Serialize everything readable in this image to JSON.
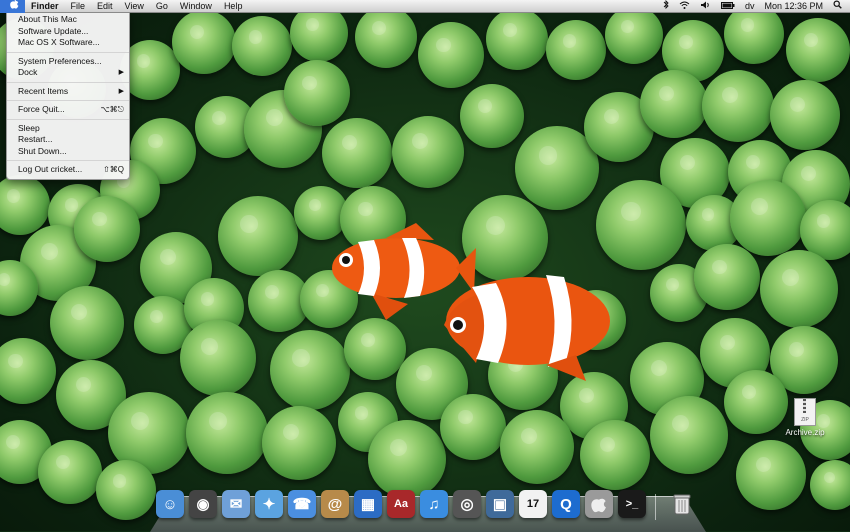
{
  "menubar": {
    "apple_icon": "",
    "items": [
      "Finder",
      "File",
      "Edit",
      "View",
      "Go",
      "Window",
      "Help"
    ],
    "status": {
      "bluetooth_icon": "bluetooth-icon",
      "wifi_icon": "wifi-icon",
      "volume_icon": "volume-icon",
      "battery_icon": "battery-icon",
      "user": "dv",
      "clock": "Mon 12:36 PM",
      "spotlight_icon": "spotlight-icon"
    }
  },
  "apple_menu": {
    "items": [
      {
        "label": "About This Mac"
      },
      {
        "label": "Software Update..."
      },
      {
        "label": "Mac OS X Software..."
      },
      {
        "separator": true
      },
      {
        "label": "System Preferences..."
      },
      {
        "label": "Dock",
        "submenu": true
      },
      {
        "separator": true
      },
      {
        "label": "Recent Items",
        "submenu": true
      },
      {
        "separator": true
      },
      {
        "label": "Force Quit...",
        "shortcut": "⌥⌘⎋"
      },
      {
        "separator": true
      },
      {
        "label": "Sleep"
      },
      {
        "label": "Restart..."
      },
      {
        "label": "Shut Down..."
      },
      {
        "separator": true
      },
      {
        "label": "Log Out cricket...",
        "shortcut": "⇧⌘Q"
      }
    ]
  },
  "desktop": {
    "wallpaper": "clownfish-anemone",
    "files": [
      {
        "label": "Archive.zip",
        "icon_text": "ZIP"
      }
    ]
  },
  "dock": {
    "apps": [
      {
        "name": "finder",
        "glyph": "☺",
        "color": "#4a8ed6"
      },
      {
        "name": "dashboard",
        "glyph": "◉",
        "color": "#444444"
      },
      {
        "name": "mail",
        "glyph": "✉",
        "color": "#6fa0d8"
      },
      {
        "name": "safari",
        "glyph": "✦",
        "color": "#5ba3e0"
      },
      {
        "name": "ichat",
        "glyph": "☎",
        "color": "#4b8fe0"
      },
      {
        "name": "address-book",
        "glyph": "@",
        "color": "#b78a4a"
      },
      {
        "name": "spaces",
        "glyph": "▦",
        "color": "#2c6cc4"
      },
      {
        "name": "dictionary",
        "glyph": "Aa",
        "color": "#a8282a"
      },
      {
        "name": "itunes",
        "glyph": "♫",
        "color": "#3a8de0"
      },
      {
        "name": "dvd-player",
        "glyph": "◎",
        "color": "#555555"
      },
      {
        "name": "iphoto",
        "glyph": "▣",
        "color": "#3f6a9a"
      },
      {
        "name": "ical",
        "glyph": "17",
        "color": "#f2f2f2"
      },
      {
        "name": "quicktime",
        "glyph": "Q",
        "color": "#1d6ccf"
      },
      {
        "name": "system-preferences",
        "glyph": "",
        "color": "#9a9a9a"
      },
      {
        "name": "terminal",
        "glyph": ">_",
        "color": "#1a1a1a"
      },
      {
        "name": "trash",
        "glyph": "🗑",
        "color": "#b8b8b8"
      }
    ]
  },
  "colors": {
    "menu_highlight": "#3875d7"
  }
}
